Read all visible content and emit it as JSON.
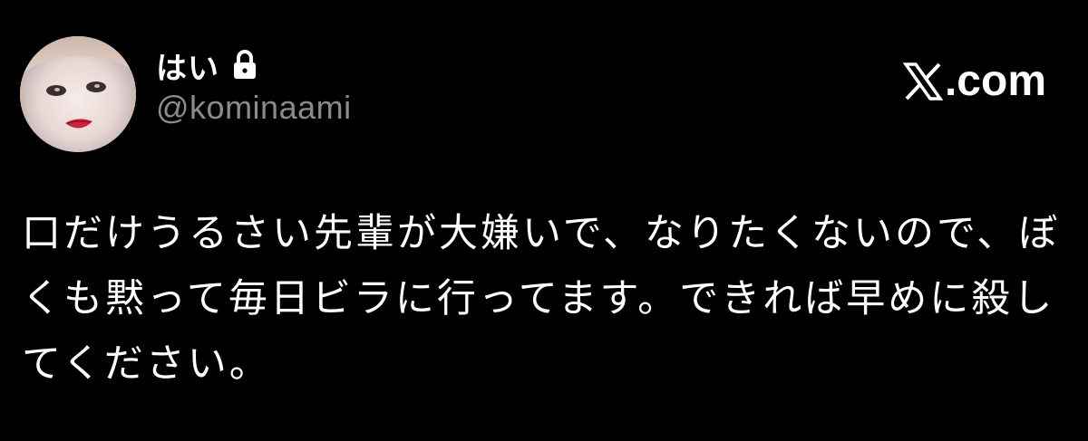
{
  "user": {
    "display_name": "はい",
    "handle": "@kominaami",
    "protected_icon": "lock-icon",
    "avatar_icon": "profile-photo"
  },
  "brand": {
    "logo_icon": "x-logo-icon",
    "text": ".com"
  },
  "tweet": {
    "lines": [
      "口だけうるさい先輩が大嫌いで、なりたくないので、ぼ",
      "くも黙って毎日ビラに行ってます。できれば早めに殺し",
      "てください。"
    ]
  },
  "colors": {
    "background": "#000000",
    "text": "#ffffff",
    "handle": "#8b8b8b"
  }
}
